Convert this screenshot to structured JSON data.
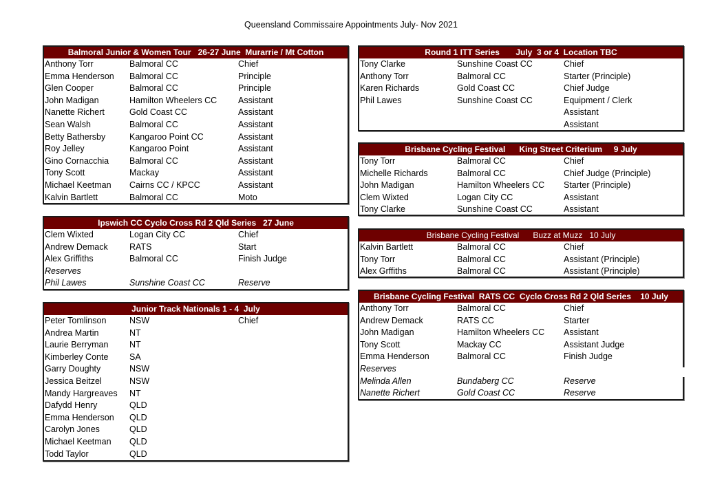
{
  "title": "Queensland Commissaire Appointments July- Nov 2021",
  "colors": {
    "header_bg": "#6e0000",
    "header_text": "#ffffff",
    "border": "#1a1a1a"
  },
  "blocks": [
    {
      "id": "balmoral-junior-women-tour",
      "header": "Balmoral Junior & Women Tour   26-27 June  Murarrie / Mt Cotton",
      "rows": [
        {
          "name": "Anthony Torr",
          "club": "Balmoral CC",
          "role": "Chief"
        },
        {
          "name": "Emma Henderson",
          "club": "Balmoral CC",
          "role": "Principle"
        },
        {
          "name": "Glen Cooper",
          "club": "Balmoral CC",
          "role": "Principle"
        },
        {
          "name": "John Madigan",
          "club": "Hamilton Wheelers CC",
          "role": "Assistant"
        },
        {
          "name": "Nanette Richert",
          "club": "Gold Coast CC",
          "role": "Assistant"
        },
        {
          "name": "Sean Walsh",
          "club": "Balmoral CC",
          "role": "Assistant"
        },
        {
          "name": "Betty Bathersby",
          "club": "Kangaroo Point CC",
          "role": "Assistant"
        },
        {
          "name": "Roy Jelley",
          "club": "Kangaroo Point",
          "role": "Assistant"
        },
        {
          "name": "Gino Cornacchia",
          "club": "Balmoral CC",
          "role": "Assistant"
        },
        {
          "name": "Tony Scott",
          "club": "Mackay",
          "role": "Assistant"
        },
        {
          "name": "Michael Keetman",
          "club": "Cairns CC / KPCC",
          "role": "Assistant"
        },
        {
          "name": "Kalvin Bartlett",
          "club": "Balmoral CC",
          "role": "Moto"
        }
      ]
    },
    {
      "id": "ipswich-cyclo-cross",
      "header": "Ipswich CC Cyclo Cross Rd 2 Qld Series   27 June",
      "rows": [
        {
          "name": "Clem Wixted",
          "club": "Logan City CC",
          "role": "Chief"
        },
        {
          "name": "Andrew Demack",
          "club": "RATS",
          "role": "Start"
        },
        {
          "name": "Alex Griffiths",
          "club": "Balmoral CC",
          "role": "Finish Judge"
        },
        {
          "name": "Reserves",
          "club": "",
          "role": "",
          "italic": true
        },
        {
          "name": "Phil Lawes",
          "club": "Sunshine Coast CC",
          "role": "Reserve",
          "italic": true
        }
      ]
    },
    {
      "id": "junior-track-nationals",
      "header": "Junior Track Nationals 1 - 4  July",
      "rows": [
        {
          "name": "Peter Tomlinson",
          "club": "NSW",
          "role": "Chief"
        },
        {
          "name": "Andrea Martin",
          "club": "NT",
          "role": ""
        },
        {
          "name": "Laurie Berryman",
          "club": "NT",
          "role": ""
        },
        {
          "name": "Kimberley  Conte",
          "club": "SA",
          "role": ""
        },
        {
          "name": "Garry Doughty",
          "club": "NSW",
          "role": ""
        },
        {
          "name": "Jessica Beitzel",
          "club": "NSW",
          "role": ""
        },
        {
          "name": "Mandy Hargreaves",
          "club": "NT",
          "role": ""
        },
        {
          "name": "Dafydd Henry",
          "club": "QLD",
          "role": ""
        },
        {
          "name": "Emma Henderson",
          "club": "QLD",
          "role": ""
        },
        {
          "name": "Carolyn Jones",
          "club": "QLD",
          "role": ""
        },
        {
          "name": "Michael Keetman",
          "club": "QLD",
          "role": ""
        },
        {
          "name": "Todd Taylor",
          "club": "QLD",
          "role": ""
        }
      ]
    },
    {
      "id": "round-1-itt-series",
      "header": "Round 1 ITT Series       July  3 or 4  Location TBC",
      "rows": [
        {
          "name": "Tony Clarke",
          "club": "Sunshine Coast CC",
          "role": "Chief"
        },
        {
          "name": "Anthony Torr",
          "club": "Balmoral CC",
          "role": "Starter (Principle)"
        },
        {
          "name": "Karen Richards",
          "club": "Gold Coast CC",
          "role": "Chief Judge"
        },
        {
          "name": "Phil Lawes",
          "club": "Sunshine Coast CC",
          "role": "Equipment / Clerk"
        },
        {
          "name": "",
          "club": "",
          "role": "Assistant"
        },
        {
          "name": "",
          "club": "",
          "role": "Assistant"
        }
      ]
    },
    {
      "id": "king-street-criterium",
      "header": "Brisbane Cycling Festival      King Street Criterium     9 July",
      "rows": [
        {
          "name": "Tony Torr",
          "club": "Balmoral CC",
          "role": "Chief"
        },
        {
          "name": "Michelle Richards",
          "club": "Balmoral CC",
          "role": "Chief Judge (Principle)"
        },
        {
          "name": "John Madigan",
          "club": "Hamilton Wheelers CC",
          "role": "Starter (Principle)"
        },
        {
          "name": "Clem Wixted",
          "club": "Logan City CC",
          "role": "Assistant"
        },
        {
          "name": "Tony Clarke",
          "club": "Sunshine Coast CC",
          "role": "Assistant"
        }
      ]
    },
    {
      "id": "buzz-at-muzz",
      "header": "Brisbane Cycling Festival      Buzz at Muzz   10 July",
      "rows": [
        {
          "name": "Kalvin Bartlett",
          "club": "Balmoral CC",
          "role": "Chief"
        },
        {
          "name": "Tony Torr",
          "club": "Balmoral CC",
          "role": "Assistant (Principle)"
        },
        {
          "name": "Alex Grffiths",
          "club": "Balmoral CC",
          "role": "Assistant (Principle)"
        }
      ]
    },
    {
      "id": "rats-cyclo-cross",
      "header": "Brisbane Cycling Festival  RATS CC  Cyclo Cross Rd 2 Qld Series    10 July",
      "rows": [
        {
          "name": "Anthony Torr",
          "club": "Balmoral CC",
          "role": "Chief"
        },
        {
          "name": "Andrew Demack",
          "club": "RATS CC",
          "role": "Starter"
        },
        {
          "name": "John Madigan",
          "club": "Hamilton Wheelers CC",
          "role": "Assistant"
        },
        {
          "name": "Tony Scott",
          "club": "Mackay CC",
          "role": "Assistant Judge"
        },
        {
          "name": "Emma Henderson",
          "club": "Balmoral CC",
          "role": "Finish Judge"
        },
        {
          "name": "Reserves",
          "club": "",
          "role": "",
          "italic": true
        },
        {
          "name": "Melinda Allen",
          "club": "Bundaberg CC",
          "role": "Reserve",
          "italic": true
        },
        {
          "name": "Nanette Richert",
          "club": "Gold Coast CC",
          "role": "Reserve",
          "italic": true
        }
      ]
    }
  ]
}
